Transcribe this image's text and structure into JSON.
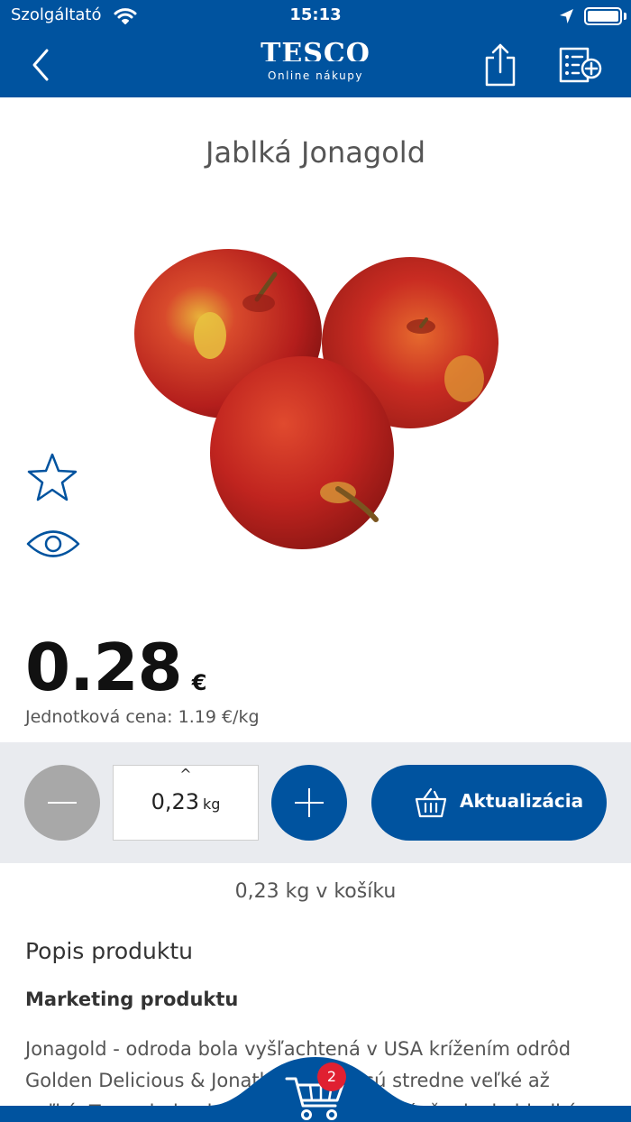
{
  "status_bar": {
    "carrier": "Szolgáltató",
    "time": "15:13",
    "battery_level": 1.0
  },
  "nav": {
    "logo_text": "TESCO",
    "logo_subtitle": "Online nákupy",
    "back_icon": "chevron-left-icon",
    "share_icon": "share-icon",
    "list_icon": "add-to-list-icon"
  },
  "product": {
    "title": "Jablká Jonagold",
    "image_alt": "three red apples",
    "price": "0.28",
    "currency": "€",
    "unit_price": "Jednotková cena: 1.19 €/kg"
  },
  "quantity": {
    "caret": "^",
    "value": "0,23",
    "unit": "kg",
    "update_label": "Aktualizácia",
    "in_cart": "0,23 kg v košíku"
  },
  "description": {
    "heading": "Popis produktu",
    "marketing_heading": "Marketing produktu",
    "text": "Jonagold - odroda bola vyšľachtená v USA krížením odrôd Golden Delicious & Jonathan. Plody sú stredne veľké až veľké. Tvar plodov je guľovitý, kužeľovitý, šupka je hladká."
  },
  "cart": {
    "badge_count": "2"
  },
  "colors": {
    "brand_blue": "#00539f",
    "band_gray": "#e9ebef",
    "badge_red": "#e02031",
    "minus_gray": "#a8a8a8"
  }
}
